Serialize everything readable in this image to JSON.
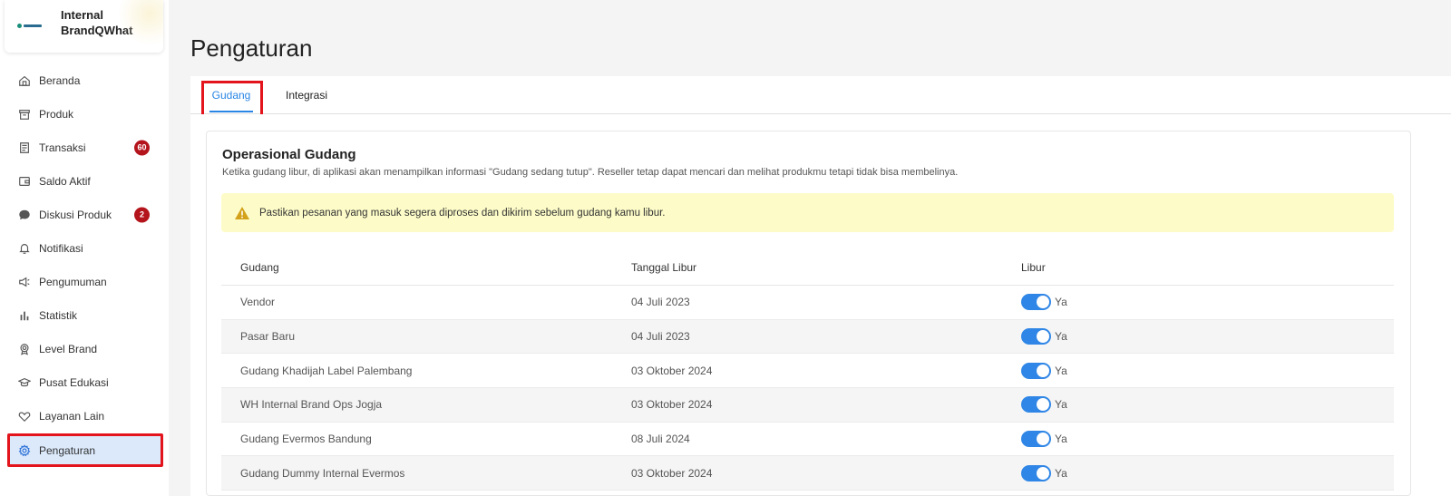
{
  "brand": {
    "name": "Internal BrandQWhat"
  },
  "sidebar": {
    "items": [
      {
        "label": "Beranda",
        "icon": "home-icon"
      },
      {
        "label": "Produk",
        "icon": "box-icon"
      },
      {
        "label": "Transaksi",
        "icon": "receipt-icon",
        "badge": "60"
      },
      {
        "label": "Saldo Aktif",
        "icon": "wallet-icon"
      },
      {
        "label": "Diskusi Produk",
        "icon": "chat-icon",
        "badge": "2"
      },
      {
        "label": "Notifikasi",
        "icon": "bell-icon"
      },
      {
        "label": "Pengumuman",
        "icon": "megaphone-icon"
      },
      {
        "label": "Statistik",
        "icon": "bar-chart-icon"
      },
      {
        "label": "Level Brand",
        "icon": "medal-icon"
      },
      {
        "label": "Pusat Edukasi",
        "icon": "graduation-cap-icon"
      },
      {
        "label": "Layanan Lain",
        "icon": "handshake-icon"
      },
      {
        "label": "Pengaturan",
        "icon": "gear-icon",
        "active": true
      }
    ]
  },
  "page": {
    "title": "Pengaturan"
  },
  "tabs": [
    {
      "label": "Gudang",
      "active": true
    },
    {
      "label": "Integrasi",
      "active": false
    }
  ],
  "card": {
    "title": "Operasional Gudang",
    "description": "Ketika gudang libur, di aplikasi akan menampilkan informasi \"Gudang sedang tutup\". Reseller tetap dapat mencari dan melihat produkmu tetapi tidak bisa membelinya.",
    "alert": "Pastikan pesanan yang masuk segera diproses dan dikirim sebelum gudang kamu libur."
  },
  "table": {
    "headers": [
      "Gudang",
      "Tanggal Libur",
      "Libur"
    ],
    "rows": [
      {
        "gudang": "Vendor",
        "tanggal": "04 Juli 2023",
        "libur": "Ya"
      },
      {
        "gudang": "Pasar Baru",
        "tanggal": "04 Juli 2023",
        "libur": "Ya"
      },
      {
        "gudang": "Gudang Khadijah Label Palembang",
        "tanggal": "03 Oktober 2024",
        "libur": "Ya"
      },
      {
        "gudang": "WH Internal Brand Ops Jogja",
        "tanggal": "03 Oktober 2024",
        "libur": "Ya"
      },
      {
        "gudang": "Gudang Evermos Bandung",
        "tanggal": "08 Juli 2024",
        "libur": "Ya"
      },
      {
        "gudang": "Gudang Dummy Internal Evermos",
        "tanggal": "03 Oktober 2024",
        "libur": "Ya"
      }
    ]
  },
  "colors": {
    "accent": "#2a86e4",
    "badge": "#b4151c",
    "highlight": "#e3141c",
    "alert_bg": "#fdfcc8",
    "toggle_on": "#2f86e6"
  }
}
